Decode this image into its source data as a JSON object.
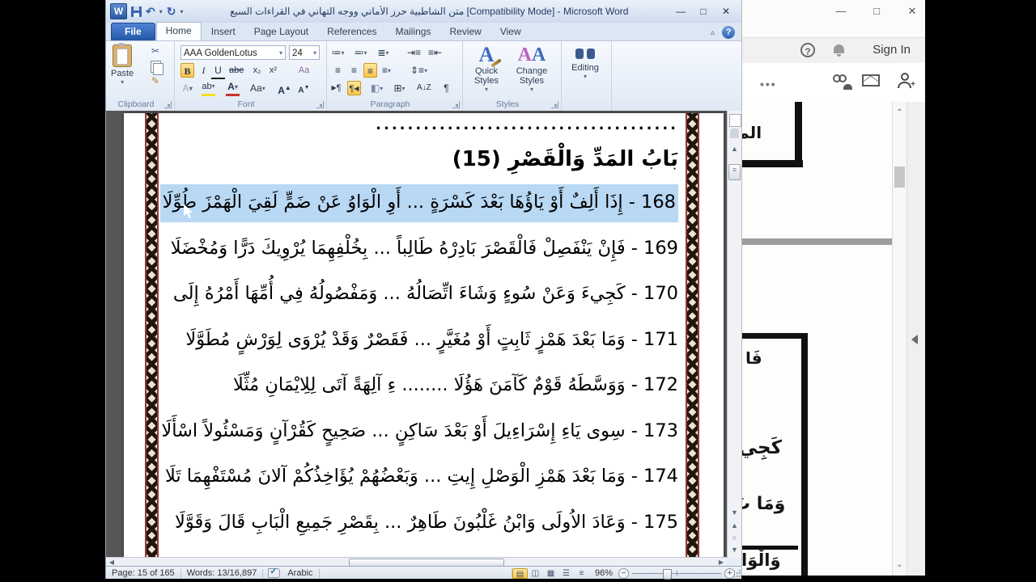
{
  "word": {
    "title": "متن الشاطبية حرز الأماني ووجه التهاني في القراءات السبع [Compatibility Mode] - Microsoft Word",
    "tabs": [
      "File",
      "Home",
      "Insert",
      "Page Layout",
      "References",
      "Mailings",
      "Review",
      "View"
    ],
    "ribbon": {
      "clipboard": {
        "label": "Clipboard",
        "paste": "Paste"
      },
      "font": {
        "label": "Font",
        "name": "AAA GoldenLotus",
        "size": "24",
        "bold": "B",
        "italic": "I",
        "underline": "U",
        "strike": "abe",
        "subscript": "x₂",
        "superscript": "x²",
        "case": "Aa",
        "grow": "A",
        "shrink": "A",
        "effects": "A",
        "highlight": "ab",
        "color": "A",
        "clear": "Aa"
      },
      "paragraph": {
        "label": "Paragraph"
      },
      "styles": {
        "label": "Styles",
        "quick": "Quick Styles",
        "change": "Change Styles"
      },
      "editing": {
        "label": "Editing"
      }
    },
    "document": {
      "dots": "......................................",
      "heading": "بَابُ المَدِّ وَالْقَصْرِ (15)",
      "verses": [
        {
          "text": "168 - إِذَا أَلِفٌ أَوْ يَاؤُهَا بَعْدَ كَسْرَةٍ ... أَوِ الْوَاوُ عَنْ ضَمٍّ لَقِيَ الْهَمْزَ طُوِّلَا",
          "highlighted": true
        },
        {
          "text": "169 - فَإِنْ يَنْفَصِلْ فَالْقَصْرَ بَادِرْهُ طَالِباً ... بِخُلْفِهِمَا يُرْوِيكَ دَرًّا وَمُخْضَلَا",
          "highlighted": false
        },
        {
          "text": "170 - كَجِيءَ وَعَنْ سُوءٍ وَشَاءَ اتِّصَالُهُ ... وَمَفْصُولُهُ فِي أُمِّهَا أَمْرُهُ إِلَى",
          "highlighted": false
        },
        {
          "text": "171 - وَمَا بَعْدَ هَمْزٍ ثَابِتٍ أَوْ مُغَيَّرٍ ... فَقَصْرٌ وَقَدْ يُرْوَى لِوَرْشٍ مُطَوَّلَا",
          "highlighted": false
        },
        {
          "text": "172 - وَوَسَّطَهُ قَوْمٌ كَآمَنَ هَؤُلَا ........ ءِ آلِهَةً آتَى لِلِايْمَانِ مُثِّلَا",
          "highlighted": false
        },
        {
          "text": "173 - سِوى يَاءِ إِسْرَاءِيلَ أَوْ بَعْدَ سَاكِنٍ ... صَحِيحٍ كَقُرْآنٍ وَمَسْئُولاً اسْأَلَا",
          "highlighted": false
        },
        {
          "text": "174 - وَمَا بَعْدَ هَمْزِ الْوَصْلِ إِيتِ ... وَبَعْضُهُمْ يُؤَاخِذُكُمْ آلانَ مُسْتَفْهِمَا تَلَا",
          "highlighted": false
        },
        {
          "text": "175 - وَعَادَ الاُولَى وَابْنُ غَلْبُونَ طَاهِرٌ ... بِقَصْرِ جَمِيعِ الْبَابِ قَالَ وَقَوَّلَا",
          "highlighted": false
        }
      ]
    },
    "statusbar": {
      "page": "Page: 15 of 165",
      "words": "Words: 13/16,897",
      "language": "Arabic",
      "zoom_level": "96%"
    },
    "colors": {
      "selection": "#b8d8f4",
      "file_tab": "#2356a6",
      "active_toggle": "#fbc54c"
    }
  },
  "reader": {
    "sign_in": "Sign In",
    "page1_text": "الم",
    "page2_fragments": [
      "فَا",
      "كَجِيءَ",
      "وَمَا بَ",
      "وَالْوَاو"
    ]
  }
}
